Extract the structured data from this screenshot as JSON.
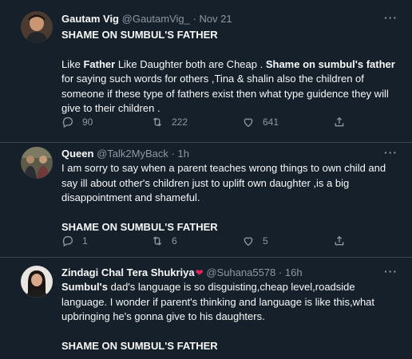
{
  "tweets": [
    {
      "name": "Gautam Vig",
      "handle": "@GautamVig_",
      "sep": "·",
      "time": "Nov 21",
      "more": "···",
      "lines": {
        "l1": "SHAME ON SUMBUL'S FATHER",
        "l2a": "Like ",
        "l2b": "Father",
        "l2c": " Like Daughter both are Cheap . ",
        "l2d": "Shame on sumbul's father",
        "l2e": " for saying such words for others ,Tina & shalin also the children of someone if these type of fathers exist then what type guidence they will give to their children ."
      },
      "replies": "90",
      "retweets": "222",
      "likes": "641"
    },
    {
      "name": "Queen",
      "handle": "@Talk2MyBack",
      "sep": "·",
      "time": "1h",
      "more": "···",
      "lines": {
        "l1": "I am sorry to say when a parent teaches wrong things to own child and say ill about other's children just to uplift own daughter ,is a big disappointment and shameful.",
        "l2": "SHAME ON SUMBUL'S FATHER"
      },
      "replies": "1",
      "retweets": "6",
      "likes": "5"
    },
    {
      "name": "Zindagi Chal Tera Shukriya",
      "handle": "@Suhana5578",
      "sep": "·",
      "time": "16h",
      "more": "···",
      "lines": {
        "l1a": "Sumbul's",
        "l1b": " dad's language is so disguisting,cheap level,roadside language. I wonder if parent's thinking and language is like this,what upbringing he's gonna give to his daughters.",
        "l2": "SHAME ON SUMBUL'S FATHER"
      }
    }
  ],
  "icons": {
    "reply": "reply-icon",
    "retweet": "retweet-icon",
    "like": "like-icon",
    "share": "share-icon",
    "heart_emoji": "heart-emoji-icon"
  },
  "colors": {
    "background": "#15202b",
    "text": "#f7f9f9",
    "muted": "#8b98a5",
    "divider": "#38444d",
    "heart": "#e0245e"
  }
}
